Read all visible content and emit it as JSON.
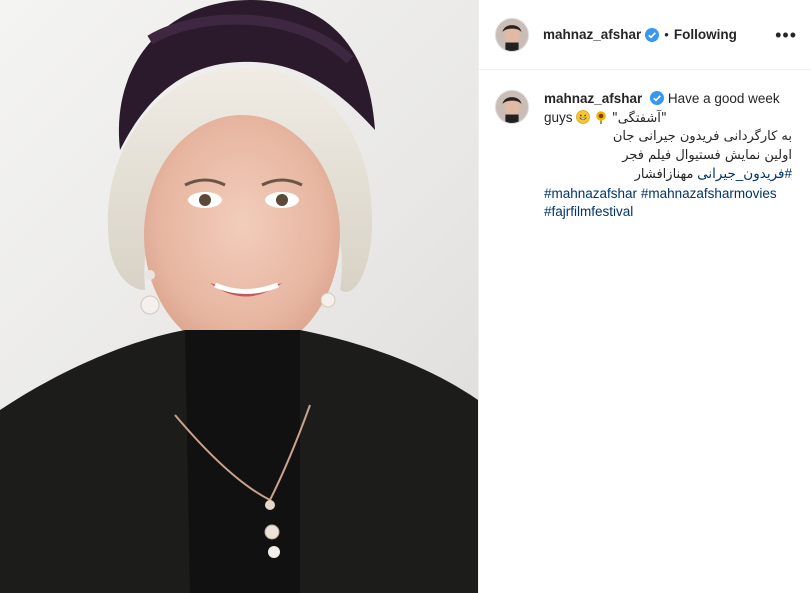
{
  "post": {
    "author": "mahnaz_afshar",
    "follow_separator": "•",
    "follow_label": "Following",
    "more_label": "•••"
  },
  "caption": {
    "author": "mahnaz_afshar",
    "text_en": "Have a good week",
    "text_en2": "guys",
    "quote": "\"آشفتگی\"",
    "line_fa_1": "به کارگردانی فریدون جیرانی جان",
    "line_fa_2": "اولین نمایش فستیوال فیلم فجر",
    "plain_fa": "مهنازافشار",
    "hashtags": [
      "#فریدون_جیرانی",
      "#mahnazafshar",
      "#mahnazafsharmovies",
      "#fajrfilmfestival"
    ]
  },
  "icons": {
    "verified": "verified-badge-icon",
    "grin": "grinning-face-emoji",
    "flower": "sunflower-emoji",
    "more": "more-options-icon"
  },
  "colors": {
    "text": "#262626",
    "hashtag": "#003569",
    "verified": "#3897f0",
    "border": "#efefef"
  }
}
